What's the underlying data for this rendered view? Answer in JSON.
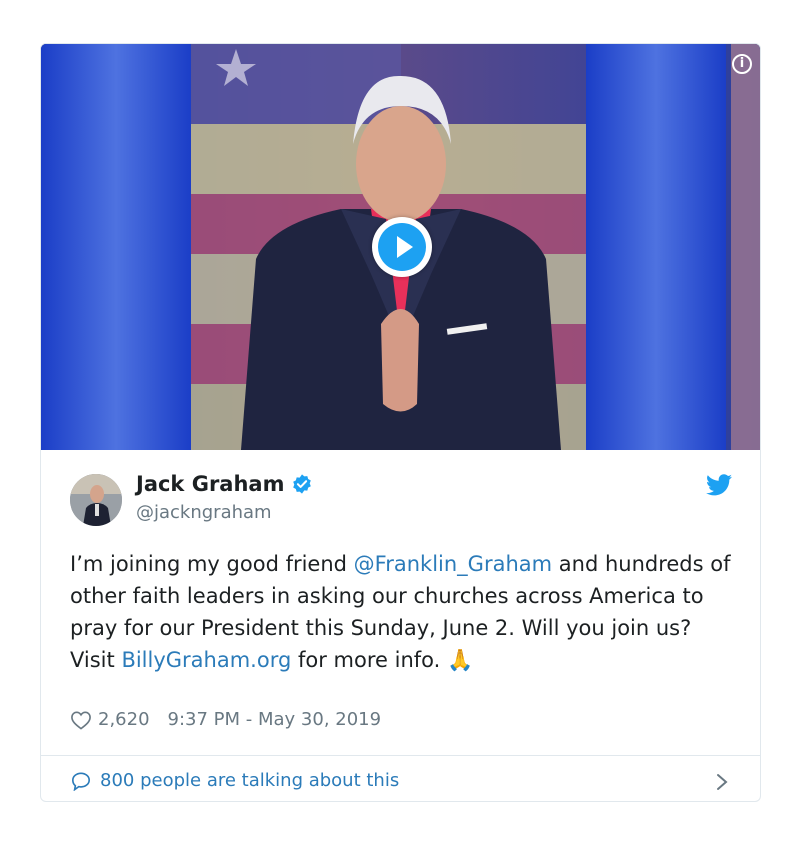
{
  "video": {
    "info_icon": "info-icon",
    "play_icon": "play-icon"
  },
  "tweet": {
    "author_name": "Jack Graham",
    "author_handle": "@jackngraham",
    "verified_icon": "verified-badge-icon",
    "brand_icon": "twitter-bird-icon",
    "text_parts": {
      "p1": "I’m joining my good friend ",
      "mention": "@Franklin_Graham",
      "p2": " and hundreds of other faith leaders in asking our churches across America to pray for our President this Sunday, June 2. Will you join us? Visit ",
      "link": "BillyGraham.org",
      "p3": " for more info. ",
      "emoji": "🙏"
    },
    "likes": "2,620",
    "timestamp": "9:37 PM - May 30, 2019",
    "talking": "800 people are talking about this"
  },
  "colors": {
    "accent": "#1da1f2",
    "link": "#2b7bb9",
    "muted": "#697882",
    "border": "#e1e8ed"
  }
}
